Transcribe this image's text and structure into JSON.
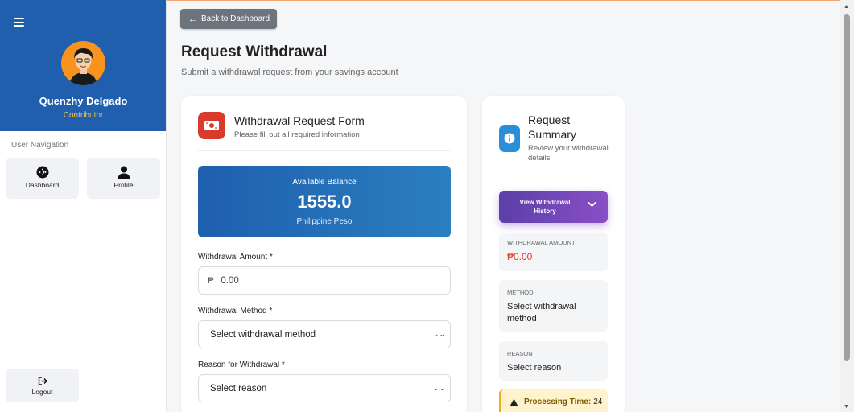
{
  "sidebar": {
    "user_name": "Quenzhy Delgado",
    "user_role": "Contributor",
    "nav_heading": "User Navigation",
    "items": [
      {
        "label": "Dashboard",
        "icon": "dashboard-icon"
      },
      {
        "label": "Profile",
        "icon": "user-icon"
      }
    ],
    "logout_label": "Logout"
  },
  "header": {
    "back_label": "Back to Dashboard",
    "title": "Request Withdrawal",
    "subtitle": "Submit a withdrawal request from your savings account"
  },
  "form": {
    "title": "Withdrawal Request Form",
    "subtitle": "Please fill out all required information",
    "balance_label": "Available Balance",
    "balance_value": "1555.0",
    "balance_currency": "Philippine Peso",
    "amount_label": "Withdrawal Amount *",
    "amount_currency_symbol": "₱",
    "amount_placeholder": "0.00",
    "method_label": "Withdrawal Method *",
    "method_value": "Select withdrawal method",
    "reason_label": "Reason for Withdrawal *",
    "reason_value": "Select reason"
  },
  "summary": {
    "title": "Request Summary",
    "subtitle": "Review your withdrawal details",
    "history_button": "View Withdrawal History",
    "amount_key": "WITHDRAWAL AMOUNT",
    "amount_value": "₱0.00",
    "method_key": "METHOD",
    "method_value": "Select withdrawal method",
    "reason_key": "REASON",
    "reason_value": "Select reason",
    "processing_label": "Processing Time:",
    "processing_value": "24"
  },
  "colors": {
    "sidebar_header": "#1f5fae",
    "accent_red": "#d93a2b",
    "amount_red": "#d93a2b",
    "purple": "#7a47bb",
    "info_blue": "#2a8fd8",
    "warning": "#fff3cd"
  }
}
